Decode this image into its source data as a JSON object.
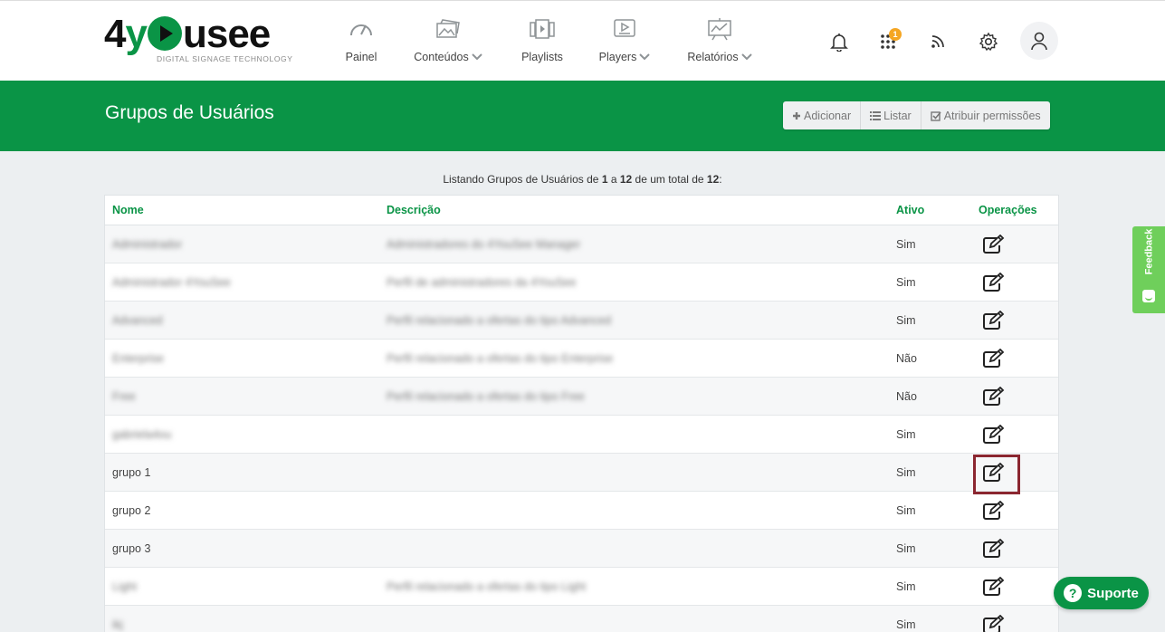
{
  "brand": {
    "name_pre": "4",
    "name_y": "y",
    "name_post": "usee",
    "tagline": "DIGITAL SIGNAGE TECHNOLOGY"
  },
  "nav": [
    {
      "label": "Painel",
      "icon": "gauge-icon",
      "dropdown": false
    },
    {
      "label": "Conteúdos",
      "icon": "images-icon",
      "dropdown": true
    },
    {
      "label": "Playlists",
      "icon": "playlist-icon",
      "dropdown": false
    },
    {
      "label": "Players",
      "icon": "player-icon",
      "dropdown": true
    },
    {
      "label": "Relatórios",
      "icon": "report-icon",
      "dropdown": true
    }
  ],
  "header_icons": {
    "notifications": "bell-icon",
    "apps": "apps-grid-icon",
    "apps_badge": "1",
    "feed": "rss-icon",
    "settings": "gear-icon",
    "user": "user-icon"
  },
  "page": {
    "title": "Grupos de Usuários"
  },
  "actions": {
    "add": "Adicionar",
    "list": "Listar",
    "assign": "Atribuir permissões"
  },
  "listing": {
    "prefix": "Listando Grupos de Usuários de ",
    "from": "1",
    "mid1": " a ",
    "to": "12",
    "mid2": " de um total de ",
    "total": "12",
    "suffix": ":"
  },
  "table": {
    "headers": {
      "name": "Nome",
      "description": "Descrição",
      "active": "Ativo",
      "operations": "Operações"
    },
    "rows": [
      {
        "name": "Administrador",
        "description": "Administradores do 4YouSee Manager",
        "active": "Sim",
        "blurred": true
      },
      {
        "name": "Administrador 4YouSee",
        "description": "Perfil de administradores da 4YouSee",
        "active": "Sim",
        "blurred": true
      },
      {
        "name": "Advanced",
        "description": "Perfil relacionado a ofertas do tipo Advanced",
        "active": "Sim",
        "blurred": true
      },
      {
        "name": "Enterprise",
        "description": "Perfil relacionado a ofertas do tipo Enterprise",
        "active": "Não",
        "blurred": true
      },
      {
        "name": "Free",
        "description": "Perfil relacionado a ofertas do tipo Free",
        "active": "Não",
        "blurred": true
      },
      {
        "name": "gabriela4ou",
        "description": "",
        "active": "Sim",
        "blurred": true
      },
      {
        "name": "grupo 1",
        "description": "",
        "active": "Sim",
        "blurred": false
      },
      {
        "name": "grupo 2",
        "description": "",
        "active": "Sim",
        "blurred": false
      },
      {
        "name": "grupo 3",
        "description": "",
        "active": "Sim",
        "blurred": false
      },
      {
        "name": "Light",
        "description": "Perfil relacionado a ofertas do tipo Light",
        "active": "Sim",
        "blurred": true
      },
      {
        "name": "ikj",
        "description": "",
        "active": "Sim",
        "blurred": true
      }
    ]
  },
  "feedback": {
    "label": "Feedback"
  },
  "support": {
    "label": "Suporte",
    "symbol": "?"
  }
}
